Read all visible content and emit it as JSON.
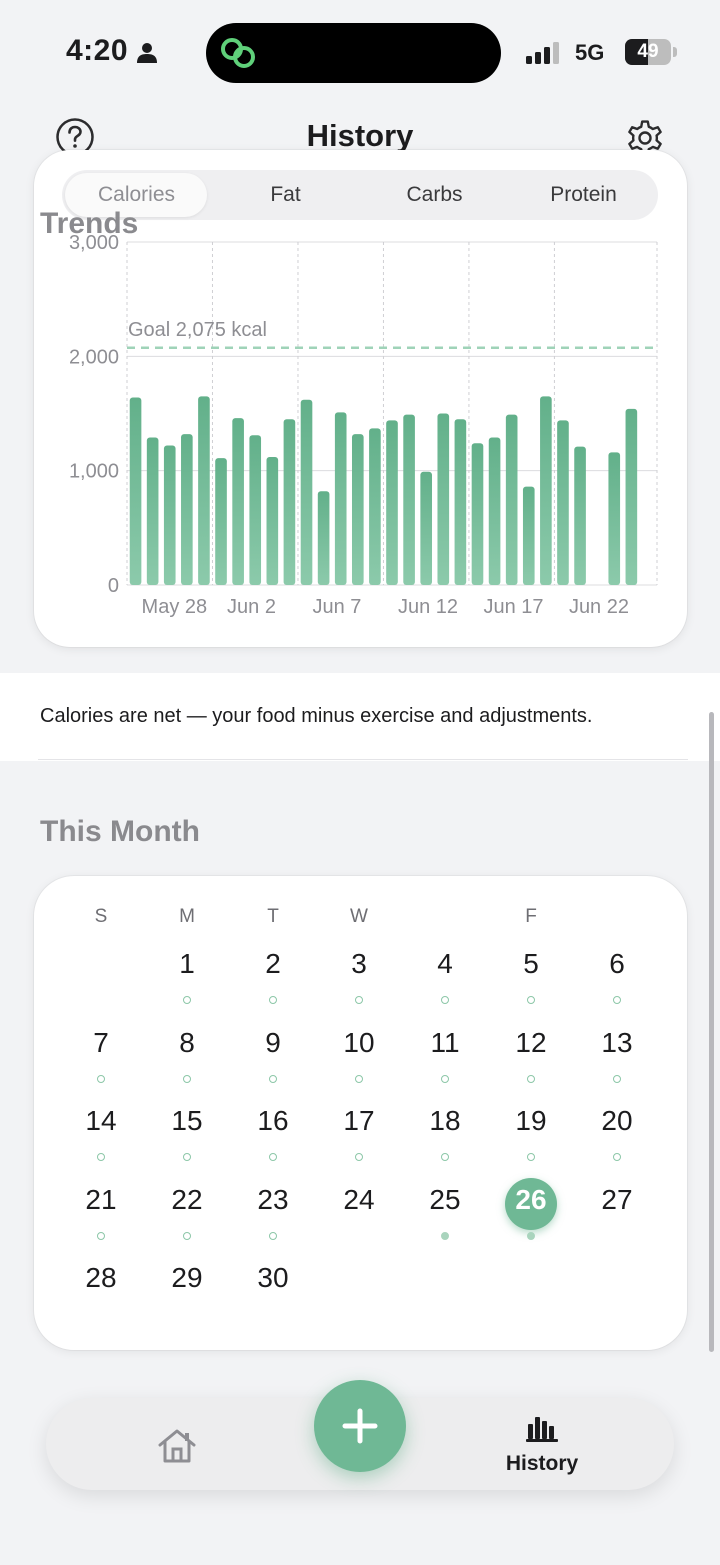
{
  "status_bar": {
    "time": "4:20",
    "network": "5G",
    "battery_level": "49",
    "battery_fraction": 0.49
  },
  "header": {
    "title": "History",
    "help_icon": "question-circle-icon",
    "settings_icon": "gear-icon"
  },
  "trends": {
    "section_title": "Trends",
    "tabs": [
      "Calories",
      "Fat",
      "Carbs",
      "Protein"
    ],
    "active_tab": "Calories"
  },
  "chart_data": {
    "type": "bar",
    "title": "",
    "xlabel": "",
    "ylabel": "",
    "ylim": [
      0,
      3000
    ],
    "yticks": [
      0,
      1000,
      2000,
      3000
    ],
    "ytick_labels": [
      "0",
      "1,000",
      "2,000",
      "3,000"
    ],
    "goal": {
      "value": 2075,
      "label": "Goal 2,075 kcal"
    },
    "x_tick_labels": [
      "May 28",
      "Jun 2",
      "Jun 7",
      "Jun 12",
      "Jun 17",
      "Jun 22"
    ],
    "x": [
      "May 27",
      "May 28",
      "May 29",
      "May 30",
      "May 31",
      "Jun 1",
      "Jun 2",
      "Jun 3",
      "Jun 4",
      "Jun 5",
      "Jun 6",
      "Jun 7",
      "Jun 8",
      "Jun 9",
      "Jun 10",
      "Jun 11",
      "Jun 12",
      "Jun 13",
      "Jun 14",
      "Jun 15",
      "Jun 16",
      "Jun 17",
      "Jun 18",
      "Jun 19",
      "Jun 20",
      "Jun 21",
      "Jun 22",
      "Jun 23",
      "Jun 24",
      "Jun 25",
      "Jun 26"
    ],
    "values": [
      1640,
      1290,
      1220,
      1320,
      1650,
      1110,
      1460,
      1310,
      1120,
      1450,
      1620,
      820,
      1510,
      1320,
      1370,
      1440,
      1490,
      990,
      1500,
      1450,
      1240,
      1290,
      1490,
      860,
      1650,
      1440,
      1210,
      0,
      1160,
      1540
    ],
    "grid": true,
    "bar_color": "#6cb692"
  },
  "note": {
    "text": "Calories are net — your food minus exercise and adjustments."
  },
  "month": {
    "section_title": "This Month",
    "weekdays": [
      "S",
      "M",
      "T",
      "W",
      "",
      "F",
      ""
    ],
    "days": [
      {
        "n": "1",
        "col": 1,
        "row": 0,
        "dot": "hollow"
      },
      {
        "n": "2",
        "col": 2,
        "row": 0,
        "dot": "hollow"
      },
      {
        "n": "3",
        "col": 3,
        "row": 0,
        "dot": "hollow"
      },
      {
        "n": "4",
        "col": 4,
        "row": 0,
        "dot": "hollow"
      },
      {
        "n": "5",
        "col": 5,
        "row": 0,
        "dot": "hollow"
      },
      {
        "n": "6",
        "col": 6,
        "row": 0,
        "dot": "hollow"
      },
      {
        "n": "7",
        "col": 0,
        "row": 1,
        "dot": "hollow"
      },
      {
        "n": "8",
        "col": 1,
        "row": 1,
        "dot": "hollow"
      },
      {
        "n": "9",
        "col": 2,
        "row": 1,
        "dot": "hollow"
      },
      {
        "n": "10",
        "col": 3,
        "row": 1,
        "dot": "hollow"
      },
      {
        "n": "11",
        "col": 4,
        "row": 1,
        "dot": "hollow"
      },
      {
        "n": "12",
        "col": 5,
        "row": 1,
        "dot": "hollow"
      },
      {
        "n": "13",
        "col": 6,
        "row": 1,
        "dot": "hollow"
      },
      {
        "n": "14",
        "col": 0,
        "row": 2,
        "dot": "hollow"
      },
      {
        "n": "15",
        "col": 1,
        "row": 2,
        "dot": "hollow"
      },
      {
        "n": "16",
        "col": 2,
        "row": 2,
        "dot": "hollow"
      },
      {
        "n": "17",
        "col": 3,
        "row": 2,
        "dot": "hollow"
      },
      {
        "n": "18",
        "col": 4,
        "row": 2,
        "dot": "hollow"
      },
      {
        "n": "19",
        "col": 5,
        "row": 2,
        "dot": "hollow"
      },
      {
        "n": "20",
        "col": 6,
        "row": 2,
        "dot": "hollow"
      },
      {
        "n": "21",
        "col": 0,
        "row": 3,
        "dot": "hollow"
      },
      {
        "n": "22",
        "col": 1,
        "row": 3,
        "dot": "hollow"
      },
      {
        "n": "23",
        "col": 2,
        "row": 3,
        "dot": "hollow"
      },
      {
        "n": "24",
        "col": 3,
        "row": 3,
        "dot": "none"
      },
      {
        "n": "25",
        "col": 4,
        "row": 3,
        "dot": "filled"
      },
      {
        "n": "26",
        "col": 5,
        "row": 3,
        "dot": "filled",
        "selected": true
      },
      {
        "n": "27",
        "col": 6,
        "row": 3,
        "dot": "none"
      },
      {
        "n": "28",
        "col": 0,
        "row": 4,
        "dot": "none"
      },
      {
        "n": "29",
        "col": 1,
        "row": 4,
        "dot": "none"
      },
      {
        "n": "30",
        "col": 2,
        "row": 4,
        "dot": "none"
      }
    ]
  },
  "tab_bar": {
    "home_icon": "home-icon",
    "add_icon": "plus-icon",
    "history_icon": "bar-chart-icon",
    "history_label": "History"
  },
  "colors": {
    "accent": "#6fb895",
    "goal_line": "#9fd3b8"
  }
}
